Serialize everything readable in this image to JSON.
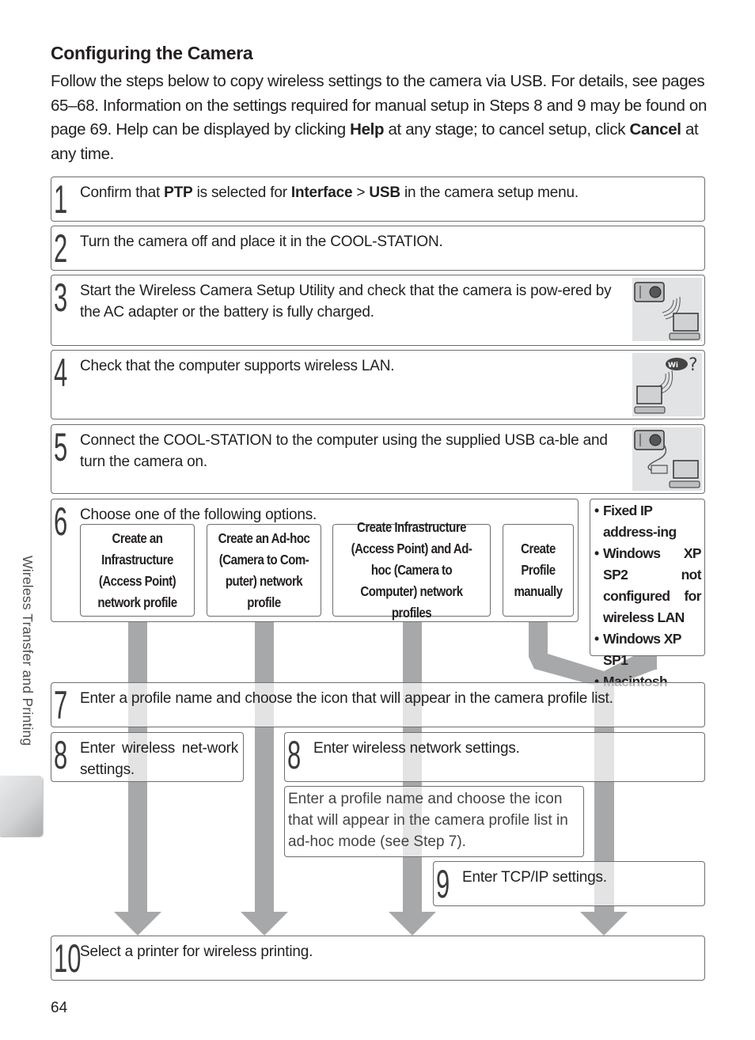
{
  "heading": "Configuring the Camera",
  "intro": {
    "part1": "Follow the steps below to copy wireless settings to the camera via USB.  For details, see pages 65–68.  Information on the settings required for manual setup in Steps 8 and 9 may be found on page 69.  Help can be displayed by clicking ",
    "help": "Help",
    "part2": " at any stage; to cancel setup, click ",
    "cancel": "Cancel",
    "part3": " at any time."
  },
  "steps": {
    "s1": {
      "num": "1",
      "t1": "Confirm that ",
      "b1": "PTP",
      "t2": " is selected for ",
      "b2": "Interface",
      "t3": " > ",
      "b3": "USB",
      "t4": " in the camera setup menu."
    },
    "s2": {
      "num": "2",
      "text": "Turn the camera off and place it in the COOL-STATION."
    },
    "s3": {
      "num": "3",
      "text": "Start the Wireless Camera Setup Utility and check that the camera is pow-ered by the AC adapter or the battery is fully charged.",
      "icon": "camera-wireless-computer-illustration"
    },
    "s4": {
      "num": "4",
      "text": "Check that the computer supports wireless LAN.",
      "icon": "wifi-question-computer-illustration"
    },
    "s5": {
      "num": "5",
      "text": "Connect the COOL-STATION to the computer using the supplied USB ca-ble and turn the camera on.",
      "icon": "camera-usb-computer-illustration"
    },
    "s6": {
      "num": "6",
      "text": "Choose one of the following options.",
      "options": [
        "Create an Infrastructure (Access Point) network profile",
        "Create an Ad-hoc (Camera to Com-puter) network profile",
        "Create Infrastructure (Access Point) and Ad-hoc (Camera to Computer) network profiles",
        "Create Profile manually"
      ],
      "manual_conditions": [
        "Fixed IP address-ing",
        "Windows XP SP2 not configured for wireless LAN",
        "Windows XP SP1",
        "Macintosh"
      ]
    },
    "s7": {
      "num": "7",
      "text": "Enter a profile name and choose the icon that will appear in the camera profile list."
    },
    "s8a": {
      "num": "8",
      "text": "Enter wireless net-work settings."
    },
    "s8b": {
      "num": "8",
      "text": "Enter wireless network settings.",
      "note": "Enter a profile name and choose the icon that will appear in the camera profile list in ad-hoc mode (see Step 7)."
    },
    "s9": {
      "num": "9",
      "text": "Enter TCP/IP settings."
    },
    "s10": {
      "num": "10",
      "text": "Select a printer for wireless printing."
    }
  },
  "side_label": "Wireless Transfer and Printing",
  "page_number": "64",
  "colors": {
    "arrow": "#a7a8aa",
    "arrow_behind_box": "#e3e3e4",
    "border": "#6d6e70",
    "illustration_bg": "#e2e3e4"
  }
}
